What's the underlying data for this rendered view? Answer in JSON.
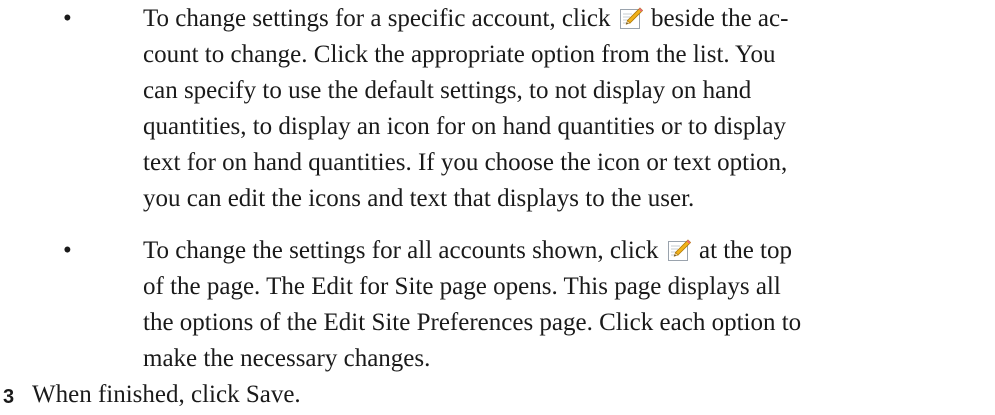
{
  "bullets": [
    {
      "marker": "•",
      "icon": "edit-pencil-icon",
      "line1_before": "To change settings for a specific account, click ",
      "line1_after": " beside the ac-",
      "lines": [
        "count to change. Click the appropriate option from the list. You",
        "can specify to use the default settings, to not display on hand",
        "quantities, to display an icon for on hand quantities or to display",
        "text for on hand quantities. If you choose the icon or text option,",
        "you can edit the icons and text that displays to the user."
      ]
    },
    {
      "marker": "•",
      "icon": "edit-pencil-icon",
      "line1_before": "To change the settings for all accounts shown, click ",
      "line1_after": " at the top",
      "lines": [
        "of the page. The Edit for Site page opens. This page displays all",
        "the options of the Edit Site Preferences page. Click each option to",
        "make the necessary changes."
      ]
    }
  ],
  "step": {
    "number": "3",
    "text": "When finished, click Save."
  }
}
